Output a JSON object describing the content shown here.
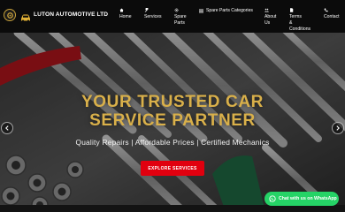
{
  "brand": {
    "name": "LUTON AUTOMOTIVE LTD",
    "logo_icon": "gear-logo-icon",
    "car_icon": "car-icon"
  },
  "nav": {
    "home": "Home",
    "services": "Services",
    "spare_parts_line1": "Spare",
    "spare_parts_line2": "Parts",
    "spare_parts_categories": "Spare Parts Categories",
    "about_line1": "About",
    "about_line2": "Us",
    "terms_line1": "Terms",
    "terms_line2": "&",
    "terms_line3": "Conditions",
    "contact": "Contact"
  },
  "hero": {
    "headline_line1": "YOUR TRUSTED CAR",
    "headline_line2": "SERVICE PARTNER",
    "tagline": "Quality Repairs | Affordable Prices | Certified Mechanics",
    "cta_label": "EXPLORE SERVICES"
  },
  "whatsapp": {
    "label": "Chat with us on WhatsApp"
  },
  "colors": {
    "header_bg": "#0b0b0b",
    "accent_gold": "#d9b04a",
    "cta_red": "#e1000f",
    "whatsapp_green": "#25d366"
  }
}
